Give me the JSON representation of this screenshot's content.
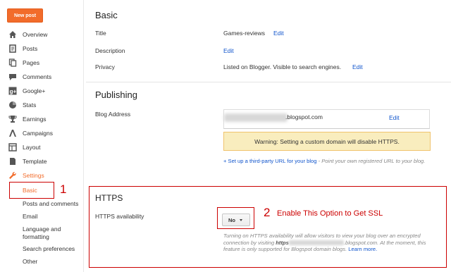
{
  "sidebar": {
    "new_post": "New post",
    "items": [
      {
        "label": "Overview",
        "icon": "home-icon"
      },
      {
        "label": "Posts",
        "icon": "posts-icon"
      },
      {
        "label": "Pages",
        "icon": "pages-icon"
      },
      {
        "label": "Comments",
        "icon": "comment-icon"
      },
      {
        "label": "Google+",
        "icon": "google-plus-icon"
      },
      {
        "label": "Stats",
        "icon": "pie-chart-icon"
      },
      {
        "label": "Earnings",
        "icon": "trophy-icon"
      },
      {
        "label": "Campaigns",
        "icon": "campaigns-icon"
      },
      {
        "label": "Layout",
        "icon": "layout-icon"
      },
      {
        "label": "Template",
        "icon": "template-icon"
      },
      {
        "label": "Settings",
        "icon": "wrench-icon"
      }
    ],
    "settings_sub": [
      "Basic",
      "Posts and comments",
      "Email",
      "Language and",
      "formatting",
      "Search preferences",
      "Other"
    ]
  },
  "basic": {
    "title": "Basic",
    "rows": {
      "title_label": "Title",
      "title_value": "Games-reviews",
      "description_label": "Description",
      "privacy_label": "Privacy",
      "privacy_value": "Listed on Blogger. Visible to search engines.",
      "edit": "Edit"
    }
  },
  "publishing": {
    "title": "Publishing",
    "blog_address_label": "Blog Address",
    "address_suffix": ".blogspot.com",
    "edit": "Edit",
    "warning": "Warning: Setting a custom domain will disable HTTPS.",
    "third_party_link": "+ Set up a third-party URL for your blog",
    "third_party_text": " - Point your own registered URL to your blog."
  },
  "https": {
    "title": "HTTPS",
    "availability_label": "HTTPS availability",
    "select_value": "No",
    "help_1": "Turning on HTTPS availability will allow visitors to view your blog over an encrypted connection by visiting ",
    "help_https": "https",
    "help_2": ".blogspot.com. At the moment, this feature is only supported for Blogspot domain blogs. ",
    "learn_more": "Learn more."
  },
  "annotations": {
    "one": "1",
    "two": "2",
    "two_text": "Enable This Option to Get SSL",
    "color": "#cc0000"
  },
  "colors": {
    "accent": "#f26c2b",
    "link": "#1155cc"
  }
}
